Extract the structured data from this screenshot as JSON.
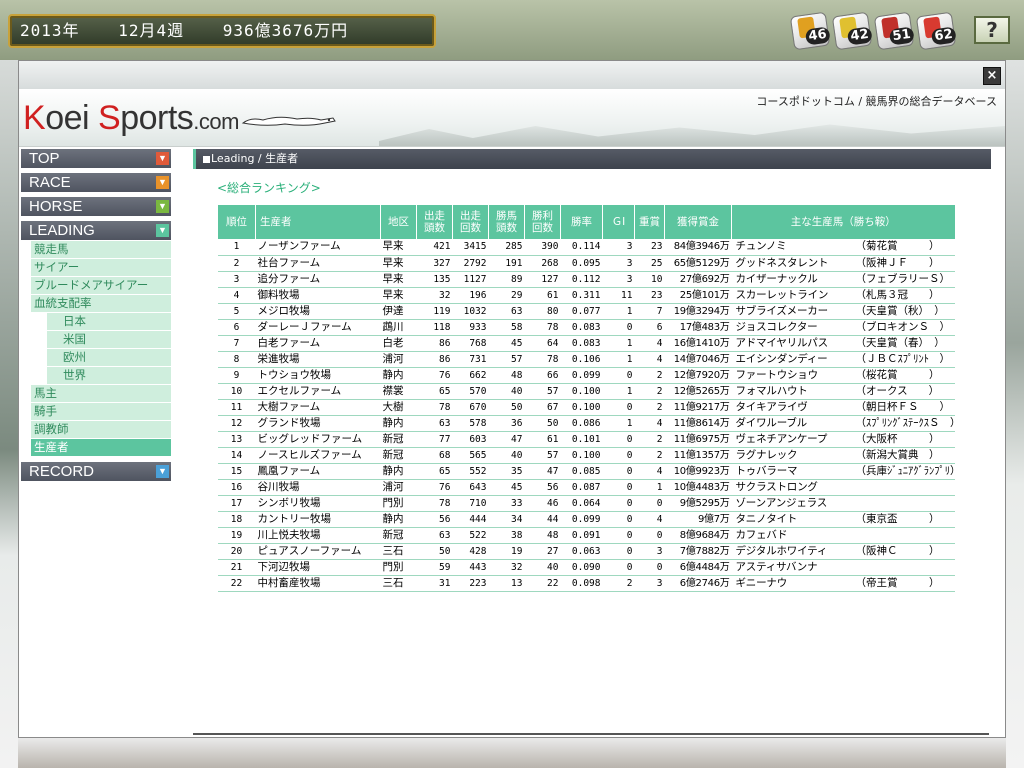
{
  "status": {
    "year": "2013年",
    "week": "12月4週",
    "money": "936億3676万円"
  },
  "badges": [
    {
      "value": "46",
      "color": "#e0a020"
    },
    {
      "value": "42",
      "color": "#e0c030"
    },
    {
      "value": "51",
      "color": "#c0302a"
    },
    {
      "value": "62",
      "color": "#d83a30"
    }
  ],
  "help_label": "?",
  "window": {
    "close_label": "×"
  },
  "site": {
    "logo": {
      "k": "K",
      "oei": "oei ",
      "s": "S",
      "ports": "ports",
      "com": ".com"
    },
    "tagline": "コースポドットコム / 競馬界の総合データベース"
  },
  "nav": {
    "top": "TOP",
    "race": "RACE",
    "horse": "HORSE",
    "leading": "LEADING",
    "record": "RECORD",
    "leading_items": [
      "競走馬",
      "サイアー",
      "ブルードメアサイアー",
      "血統支配率",
      "日本",
      "米国",
      "欧州",
      "世界",
      "馬主",
      "騎手",
      "調教師",
      "生産者"
    ],
    "colors": {
      "top": "#e05a3a",
      "race": "#e8922a",
      "horse": "#7ab840",
      "leading": "#5cc59f",
      "record": "#4aa0d8"
    }
  },
  "breadcrumb": "Leading / 生産者",
  "section_title": "<総合ランキング>",
  "table": {
    "headers": [
      "順位",
      "生産者",
      "地区",
      "出走\n頭数",
      "出走\n回数",
      "勝馬\n頭数",
      "勝利\n回数",
      "勝率",
      "ＧⅠ",
      "重賞",
      "獲得賞金",
      "主な生産馬（勝ち鞍）"
    ],
    "rows": [
      [
        "1",
        "ノーザンファーム",
        "早来",
        "421",
        "3415",
        "285",
        "390",
        "0.114",
        "3",
        "23",
        "84億3946万",
        "チュンノミ",
        "（菊花賞　　　）"
      ],
      [
        "2",
        "社台ファーム",
        "早来",
        "327",
        "2792",
        "191",
        "268",
        "0.095",
        "3",
        "25",
        "65億5129万",
        "グッドネスタレント",
        "（阪神ＪＦ　　）"
      ],
      [
        "3",
        "追分ファーム",
        "早来",
        "135",
        "1127",
        "89",
        "127",
        "0.112",
        "3",
        "10",
        "27億692万",
        "カイザーナックル",
        "（フェブラリーＳ）"
      ],
      [
        "4",
        "御料牧場",
        "早来",
        "32",
        "196",
        "29",
        "61",
        "0.311",
        "11",
        "23",
        "25億101万",
        "スカーレットライン",
        "（札馬３冠　　）"
      ],
      [
        "5",
        "メジロ牧場",
        "伊達",
        "119",
        "1032",
        "63",
        "80",
        "0.077",
        "1",
        "7",
        "19億3294万",
        "サブライズメーカー",
        "（天皇賞（秋）　）"
      ],
      [
        "6",
        "ダーレーＪファーム",
        "鵡川",
        "118",
        "933",
        "58",
        "78",
        "0.083",
        "0",
        "6",
        "17億483万",
        "ジョスコレクター",
        "（ブロキオンＳ　）"
      ],
      [
        "7",
        "白老ファーム",
        "白老",
        "86",
        "768",
        "45",
        "64",
        "0.083",
        "1",
        "4",
        "16億1410万",
        "アドマイヤリルパス",
        "（天皇賞（春）　）"
      ],
      [
        "8",
        "栄進牧場",
        "浦河",
        "86",
        "731",
        "57",
        "78",
        "0.106",
        "1",
        "4",
        "14億7046万",
        "エイシンダンディー",
        "（ＪＢＣｽﾌﾟﾘﾝﾄ　）"
      ],
      [
        "9",
        "トウショウ牧場",
        "静内",
        "76",
        "662",
        "48",
        "66",
        "0.099",
        "0",
        "2",
        "12億7920万",
        "ファートウショウ",
        "（桜花賞　　　）"
      ],
      [
        "10",
        "エクセルファーム",
        "襟裳",
        "65",
        "570",
        "40",
        "57",
        "0.100",
        "1",
        "2",
        "12億5265万",
        "フォマルハウト",
        "（オークス　　）"
      ],
      [
        "11",
        "大樹ファーム",
        "大樹",
        "78",
        "670",
        "50",
        "67",
        "0.100",
        "0",
        "2",
        "11億9217万",
        "タイキアライヴ",
        "（朝日杯ＦＳ　　）"
      ],
      [
        "12",
        "グランド牧場",
        "静内",
        "63",
        "578",
        "36",
        "50",
        "0.086",
        "1",
        "4",
        "11億8614万",
        "ダイワルーブル",
        "（ｽﾌﾟﾘﾝｸﾞｽﾃｰｸｽＳ　）"
      ],
      [
        "13",
        "ビッグレッドファーム",
        "新冠",
        "77",
        "603",
        "47",
        "61",
        "0.101",
        "0",
        "2",
        "11億6975万",
        "ヴェネチアンケープ",
        "（大阪杯　　　）"
      ],
      [
        "14",
        "ノースヒルズファーム",
        "新冠",
        "68",
        "565",
        "40",
        "57",
        "0.100",
        "0",
        "2",
        "11億1357万",
        "ラグナレック",
        "（新潟大賞典　）"
      ],
      [
        "15",
        "鳳凰ファーム",
        "静内",
        "65",
        "552",
        "35",
        "47",
        "0.085",
        "0",
        "4",
        "10億9923万",
        "トゥバラーマ",
        "（兵庫ｼﾞｭﾆｱｸﾞﾗﾝﾌﾟﾘ）"
      ],
      [
        "16",
        "谷川牧場",
        "浦河",
        "76",
        "643",
        "45",
        "56",
        "0.087",
        "0",
        "1",
        "10億4483万",
        "サクラストロング",
        ""
      ],
      [
        "17",
        "シンボリ牧場",
        "門別",
        "78",
        "710",
        "33",
        "46",
        "0.064",
        "0",
        "0",
        "9億5295万",
        "ゾーンアンジェラス",
        ""
      ],
      [
        "18",
        "カントリー牧場",
        "静内",
        "56",
        "444",
        "34",
        "44",
        "0.099",
        "0",
        "4",
        "9億7万",
        "タニノタイト",
        "（東京盃　　　）"
      ],
      [
        "19",
        "川上悦夫牧場",
        "新冠",
        "63",
        "522",
        "38",
        "48",
        "0.091",
        "0",
        "0",
        "8億9684万",
        "カフェバド",
        ""
      ],
      [
        "20",
        "ピュアスノーファーム",
        "三石",
        "50",
        "428",
        "19",
        "27",
        "0.063",
        "0",
        "3",
        "7億7882万",
        "デジタルホワイティ",
        "（阪神Ｃ　　　）"
      ],
      [
        "21",
        "下河辺牧場",
        "門別",
        "59",
        "443",
        "32",
        "40",
        "0.090",
        "0",
        "0",
        "6億4484万",
        "アスティサバンナ",
        ""
      ],
      [
        "22",
        "中村畜産牧場",
        "三石",
        "31",
        "223",
        "13",
        "22",
        "0.098",
        "2",
        "3",
        "6億2746万",
        "ギニーナウ",
        "（帝王賞　　　）"
      ]
    ]
  }
}
